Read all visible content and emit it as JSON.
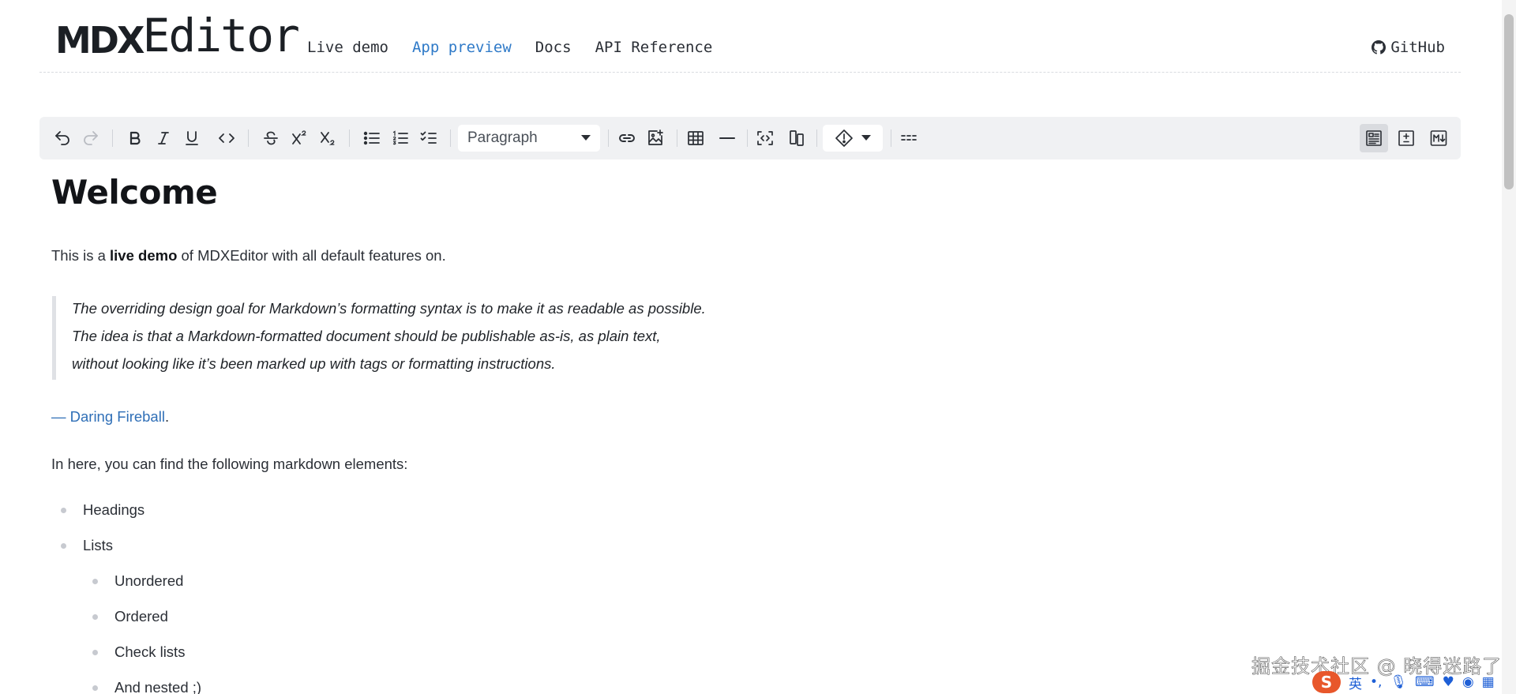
{
  "header": {
    "logo_mdx": "MDX",
    "logo_editor": "Editor",
    "nav": [
      {
        "label": "Live demo"
      },
      {
        "label": "App preview"
      },
      {
        "label": "Docs"
      },
      {
        "label": "API Reference"
      }
    ],
    "github_label": "GitHub"
  },
  "toolbar": {
    "block_type": "Paragraph",
    "active_view": "rich-text"
  },
  "content": {
    "title": "Welcome",
    "intro_before": "This is a ",
    "intro_bold": "live demo",
    "intro_after": " of MDXEditor with all default features on.",
    "quote_lines": [
      "The overriding design goal for Markdown’s formatting syntax is to make it as readable as possible.",
      "The idea is that a Markdown-formatted document should be publishable as-is, as plain text,",
      "without looking like it’s been marked up with tags or formatting instructions."
    ],
    "attribution_link": "— Daring Fireball",
    "attribution_after": ".",
    "elements_intro": "In here, you can find the following markdown elements:",
    "list_top": [
      "Headings",
      "Lists"
    ],
    "list_nested": [
      "Unordered",
      "Ordered",
      "Check lists",
      "And nested ;)"
    ]
  },
  "watermark": "掘金技术社区 @ 晓得迷路了",
  "ime": {
    "lang": "英"
  }
}
